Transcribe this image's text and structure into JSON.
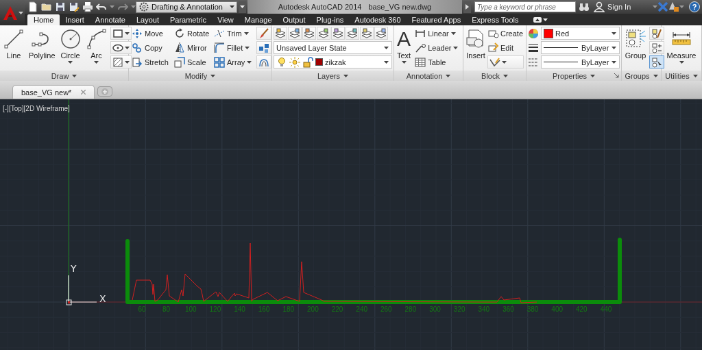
{
  "title_bar": {
    "workspace": "Drafting & Annotation",
    "app_title": "Autodesk AutoCAD 2014",
    "file_name": "base_VG new.dwg",
    "search": {
      "placeholder": "Type a keyword or phrase"
    },
    "sign_in": "Sign In",
    "help": "?"
  },
  "ribbon_tabs": [
    {
      "label": "Home",
      "selected": true
    },
    {
      "label": "Insert",
      "selected": false
    },
    {
      "label": "Annotate",
      "selected": false
    },
    {
      "label": "Layout",
      "selected": false
    },
    {
      "label": "Parametric",
      "selected": false
    },
    {
      "label": "View",
      "selected": false
    },
    {
      "label": "Manage",
      "selected": false
    },
    {
      "label": "Output",
      "selected": false
    },
    {
      "label": "Plug-ins",
      "selected": false
    },
    {
      "label": "Autodesk 360",
      "selected": false
    },
    {
      "label": "Featured Apps",
      "selected": false
    },
    {
      "label": "Express Tools",
      "selected": false
    }
  ],
  "panels": [
    {
      "kind": "draw",
      "title": "Draw",
      "tools": [
        "Line",
        "Polyline",
        "Circle",
        "Arc"
      ]
    },
    {
      "kind": "modify",
      "title": "Modify",
      "tools": [
        "Move",
        "Rotate",
        "Trim",
        "Copy",
        "Mirror",
        "Fillet",
        "Stretch",
        "Scale",
        "Array"
      ]
    },
    {
      "kind": "layers",
      "title": "Layers",
      "layer_state": "Unsaved Layer State",
      "layer": {
        "name": "zikzak",
        "color": "#a00000"
      }
    },
    {
      "kind": "annotation",
      "title": "Annotation",
      "glyph": "A",
      "label": "Text",
      "tools": [
        "Linear",
        "Leader",
        "Table"
      ]
    },
    {
      "kind": "block",
      "title": "Block",
      "label": "Insert",
      "tools": [
        "Create",
        "Edit"
      ]
    },
    {
      "kind": "properties",
      "title": "Properties",
      "color_control": {
        "label": "Red",
        "color": "#ff0000"
      },
      "lineweight": "ByLayer",
      "linetype": "ByLayer"
    },
    {
      "kind": "groups",
      "title": "Groups",
      "label": "Group",
      "tools": [
        {
          "selected": false
        },
        {
          "selected": false
        },
        {
          "selected": true
        }
      ]
    },
    {
      "kind": "utilities",
      "title": "Utilities",
      "label": "Measure"
    }
  ],
  "document_tabs": [
    {
      "label": "base_VG new*",
      "selected": true
    }
  ],
  "viewport": {
    "label": "[-][Top][2D Wireframe]",
    "ucs": {
      "x_label": "X",
      "y_label": "Y"
    },
    "scale_labels": [
      "60",
      "80",
      "100",
      "120",
      "140",
      "160",
      "180",
      "200",
      "220",
      "240",
      "260",
      "280",
      "300",
      "320",
      "340",
      "360",
      "380",
      "400",
      "420",
      "440"
    ]
  }
}
